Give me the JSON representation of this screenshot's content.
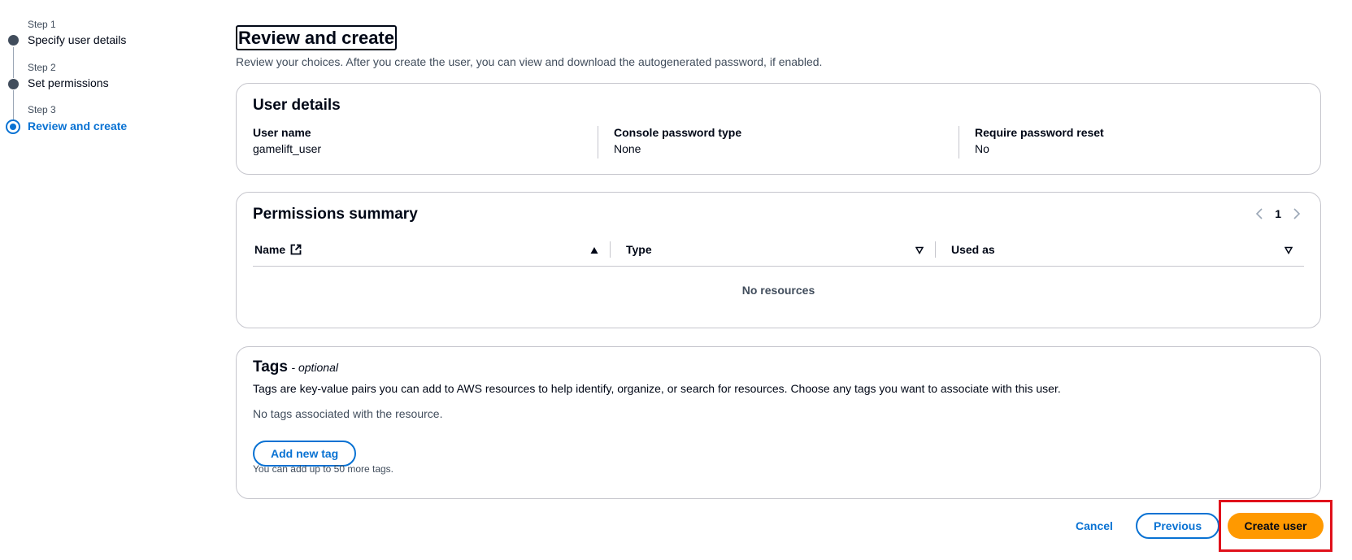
{
  "stepper": {
    "steps": [
      {
        "num": "Step 1",
        "label": "Specify user details"
      },
      {
        "num": "Step 2",
        "label": "Set permissions"
      },
      {
        "num": "Step 3",
        "label": "Review and create"
      }
    ],
    "active_index": 2
  },
  "page": {
    "title": "Review and create",
    "description": "Review your choices. After you create the user, you can view and download the autogenerated password, if enabled."
  },
  "user_details": {
    "heading": "User details",
    "fields": [
      {
        "label": "User name",
        "value": "gamelift_user"
      },
      {
        "label": "Console password type",
        "value": "None"
      },
      {
        "label": "Require password reset",
        "value": "No"
      }
    ]
  },
  "permissions": {
    "heading": "Permissions summary",
    "page_number": "1",
    "columns": [
      "Name",
      "Type",
      "Used as"
    ],
    "empty_text": "No resources"
  },
  "tags": {
    "heading": "Tags",
    "optional": "- optional",
    "description": "Tags are key-value pairs you can add to AWS resources to help identify, organize, or search for resources. Choose any tags you want to associate with this user.",
    "empty_text": "No tags associated with the resource.",
    "add_button": "Add new tag",
    "hint": "You can add up to 50 more tags."
  },
  "footer": {
    "cancel": "Cancel",
    "previous": "Previous",
    "create": "Create user"
  },
  "colors": {
    "accent": "#0972d3",
    "primary_button": "#ff9900",
    "highlight": "#e0111b"
  }
}
